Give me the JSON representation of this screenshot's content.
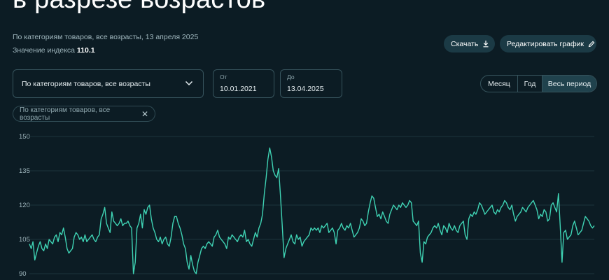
{
  "header": {
    "title": "в разрезе возрастов",
    "subtitle": "По категориям товаров, все возрасты, 13 апреля 2025",
    "index_label": "Значение индекса",
    "index_value": "110.1"
  },
  "actions": {
    "download_label": "Скачать",
    "edit_label": "Редактировать график"
  },
  "filters": {
    "category_select": "По категориям товаров, все возрасты",
    "from_label": "От",
    "from_value": "10.01.2021",
    "to_label": "До",
    "to_value": "13.04.2025",
    "chip_label": "По категориям товаров, все возрасты"
  },
  "period": {
    "month": "Месяц",
    "year": "Год",
    "all": "Весь период",
    "selected": "all"
  },
  "icons": {
    "download": "download-icon",
    "edit": "pencil-icon",
    "dropdown": "chevron-down-icon",
    "chip_remove": "close-icon"
  },
  "colors": {
    "background": "#0c1c24",
    "line": "#3fd3b4",
    "grid": "#1d343c"
  },
  "chart_data": {
    "type": "line",
    "title": "",
    "xlabel": "",
    "ylabel": "",
    "ylim": [
      90,
      150
    ],
    "yticks": [
      150,
      135,
      120,
      105,
      90
    ],
    "grid": true,
    "x_range": [
      "10.01.2021",
      "13.04.2025"
    ],
    "series": [
      {
        "values": [
          103,
          101,
          104,
          96,
          99,
          102,
          104,
          101,
          100,
          103,
          101,
          105,
          104,
          103,
          106,
          107,
          104,
          108,
          107,
          110,
          106,
          101,
          99,
          100,
          101,
          106,
          108,
          107,
          105,
          106,
          104,
          107,
          104,
          105,
          106,
          107,
          105,
          104,
          106,
          107,
          114,
          116,
          119,
          112,
          110,
          108,
          117,
          113,
          112,
          111,
          112,
          114,
          111,
          112,
          112,
          113,
          111,
          110,
          90,
          95,
          110,
          112,
          116,
          110,
          118,
          116,
          119,
          120,
          114,
          110,
          108,
          105,
          104,
          106,
          103,
          105,
          106,
          103,
          102,
          106,
          112,
          115,
          115,
          112,
          110,
          107,
          103,
          101,
          95,
          92,
          98,
          94,
          91,
          90,
          95,
          98,
          101,
          102,
          101,
          103,
          104,
          103,
          102,
          106,
          107,
          109,
          106,
          105,
          104,
          103,
          101,
          106,
          105,
          107,
          106,
          105,
          104,
          106,
          107,
          106,
          109,
          104,
          105,
          103,
          102,
          105,
          108,
          106,
          110,
          112,
          116,
          125,
          132,
          140,
          145,
          141,
          135,
          133,
          132,
          136,
          124,
          111,
          97,
          101,
          103,
          105,
          107,
          104,
          103,
          107,
          105,
          106,
          102,
          104,
          105,
          106,
          107,
          110,
          109,
          110,
          109,
          110,
          108,
          111,
          110,
          111,
          112,
          108,
          109,
          110,
          108,
          103,
          109,
          110,
          112,
          110,
          109,
          111,
          110,
          112,
          109,
          106,
          107,
          108,
          110,
          114,
          113,
          111,
          112,
          117,
          121,
          124,
          123,
          119,
          115,
          116,
          114,
          117,
          115,
          113,
          112,
          116,
          118,
          120,
          119,
          118,
          120,
          119,
          121,
          120,
          119,
          120,
          122,
          121,
          113,
          112,
          111,
          113,
          99,
          95,
          104,
          103,
          106,
          107,
          108,
          110,
          111,
          110,
          112,
          109,
          107,
          111,
          110,
          108,
          112,
          110,
          109,
          111,
          109,
          108,
          111,
          112,
          113,
          107,
          105,
          114,
          116,
          115,
          117,
          116,
          118,
          121,
          120,
          118,
          116,
          117,
          118,
          119,
          120,
          117,
          116,
          118,
          117,
          119,
          120,
          122,
          121,
          119,
          118,
          120,
          116,
          113,
          115,
          116,
          117,
          119,
          118,
          117,
          119,
          120,
          121,
          122,
          120,
          118,
          114,
          116,
          115,
          118,
          117,
          113,
          114,
          120,
          121,
          119,
          117,
          125,
          111,
          95,
          108,
          109,
          105,
          106,
          107,
          111,
          113,
          110,
          107,
          108,
          109,
          112,
          115,
          114,
          113,
          111,
          110,
          111
        ]
      }
    ]
  }
}
